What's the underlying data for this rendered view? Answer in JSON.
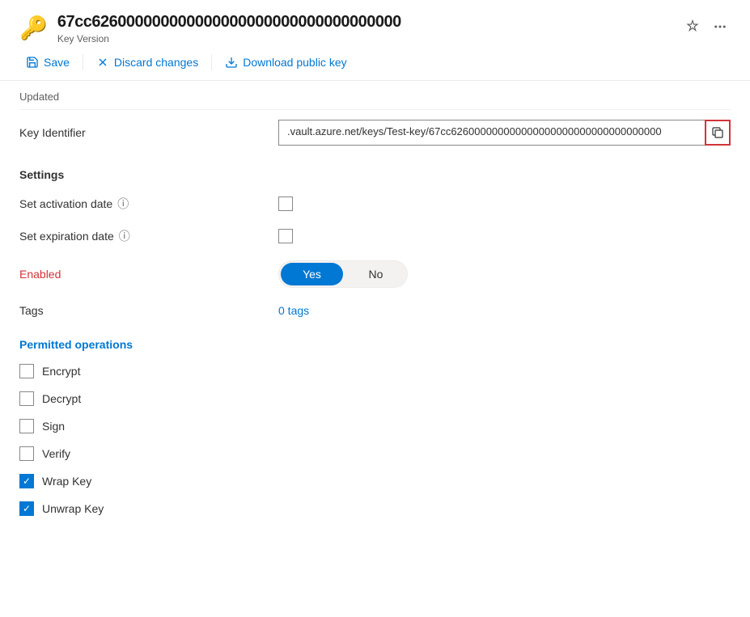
{
  "header": {
    "key_id": "67cc626000000000000000000000000000000000",
    "subtitle": "Key Version",
    "pin_icon": "📌",
    "more_icon": "···"
  },
  "toolbar": {
    "save_label": "Save",
    "discard_label": "Discard changes",
    "download_label": "Download public key"
  },
  "updated_row": {
    "label": "Updated",
    "value": ""
  },
  "key_identifier": {
    "label": "Key Identifier",
    "value": ".vault.azure.net/keys/Test-key/67cc626000000000000000000000000000000000"
  },
  "settings": {
    "header": "Settings",
    "activation_date": {
      "label": "Set activation date",
      "has_info": true,
      "checked": false
    },
    "expiration_date": {
      "label": "Set expiration date",
      "has_info": true,
      "checked": false
    },
    "enabled": {
      "label": "Enabled",
      "yes_label": "Yes",
      "no_label": "No",
      "active": "yes"
    },
    "tags": {
      "label": "Tags",
      "value": "0 tags"
    }
  },
  "permitted_operations": {
    "header": "Permitted operations",
    "operations": [
      {
        "label": "Encrypt",
        "checked": false
      },
      {
        "label": "Decrypt",
        "checked": false
      },
      {
        "label": "Sign",
        "checked": false
      },
      {
        "label": "Verify",
        "checked": false
      },
      {
        "label": "Wrap Key",
        "checked": true
      },
      {
        "label": "Unwrap Key",
        "checked": true
      }
    ]
  }
}
